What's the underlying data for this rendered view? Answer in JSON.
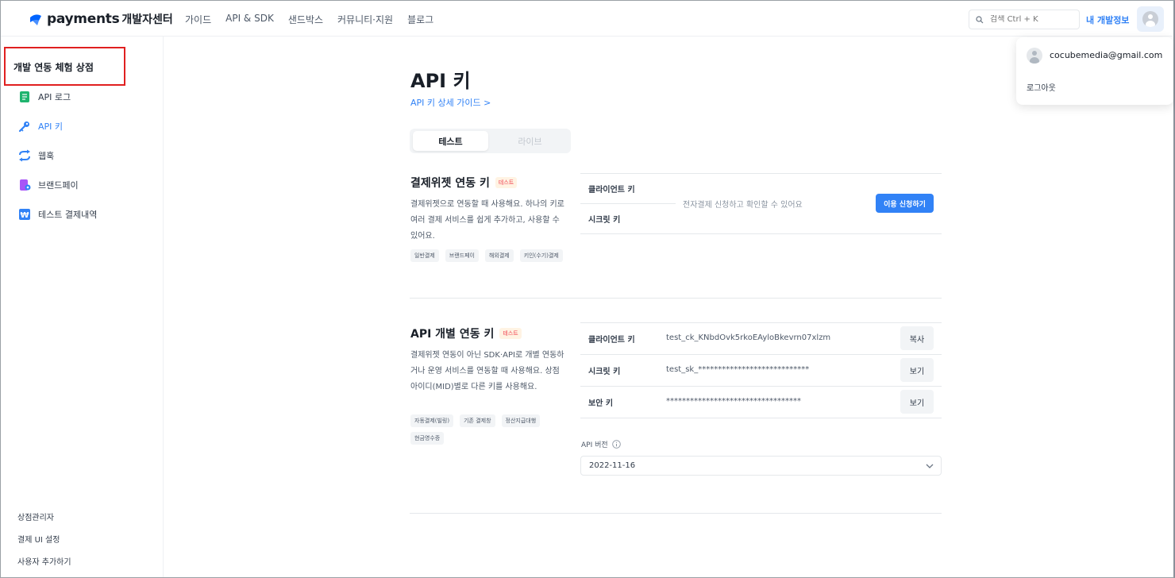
{
  "brand": {
    "name": "payments",
    "sub": "개발자센터",
    "color": "#3182f6"
  },
  "nav": {
    "items": [
      "가이드",
      "API & SDK",
      "샌드박스",
      "커뮤니티·지원",
      "블로그"
    ]
  },
  "search": {
    "placeholder": "검색 Ctrl + K"
  },
  "header": {
    "my_dev": "내 개발정보"
  },
  "account_menu": {
    "email": "cocubemedia@gmail.com",
    "logout": "로그아웃"
  },
  "sidebar": {
    "store_name": "개발 연동 체험 상점",
    "items": [
      {
        "label": "API 로그",
        "icon": "document-list-icon"
      },
      {
        "label": "API 키",
        "icon": "key-icon",
        "active": true
      },
      {
        "label": "웹훅",
        "icon": "sync-icon"
      },
      {
        "label": "브랜드페이",
        "icon": "brandpay-icon"
      },
      {
        "label": "테스트 결제내역",
        "icon": "won-receipt-icon"
      }
    ],
    "bottom": [
      "상점관리자",
      "결제 UI 설정",
      "사용자 추가하기"
    ]
  },
  "main": {
    "title": "API 키",
    "guide_link": "API 키 상세 가이드 >",
    "tabs": [
      {
        "label": "테스트",
        "selected": true
      },
      {
        "label": "라이브",
        "selected": false
      }
    ],
    "widget_section": {
      "title": "결제위젯 연동 키",
      "badge": "테스트",
      "desc": "결제위젯으로 연동할 때 사용해요. 하나의 키로 여러 결제 서비스를 쉽게 추가하고, 사용할 수 있어요.",
      "tags": [
        "일반결제",
        "브랜드페이",
        "해외결제",
        "키인(수기)결제"
      ],
      "client_key_label": "클라이언트 키",
      "secret_key_label": "시크릿 키",
      "info": "전자결제 신청하고 확인할 수 있어요",
      "apply_button": "이용 신청하기"
    },
    "api_section": {
      "title": "API 개별 연동 키",
      "badge": "테스트",
      "desc": "결제위젯 연동이 아닌 SDK·API로 개별 연동하거나 운영 서비스를 연동할 때 사용해요. 상점아이디(MID)별로 다른 키를 사용해요.",
      "tags": [
        "자동결제(빌링)",
        "기존 결제창",
        "정산지급대행",
        "현금영수증"
      ],
      "rows": [
        {
          "label": "클라이언트 키",
          "value": "test_ck_KNbdOvk5rkoEAyloBkevrn07xlzm",
          "button": "복사"
        },
        {
          "label": "시크릿 키",
          "value": "test_sk_****************************",
          "button": "보기"
        },
        {
          "label": "보안 키",
          "value": "**********************************",
          "button": "보기"
        }
      ],
      "api_version_label": "API 버전",
      "api_version_value": "2022-11-16"
    }
  }
}
